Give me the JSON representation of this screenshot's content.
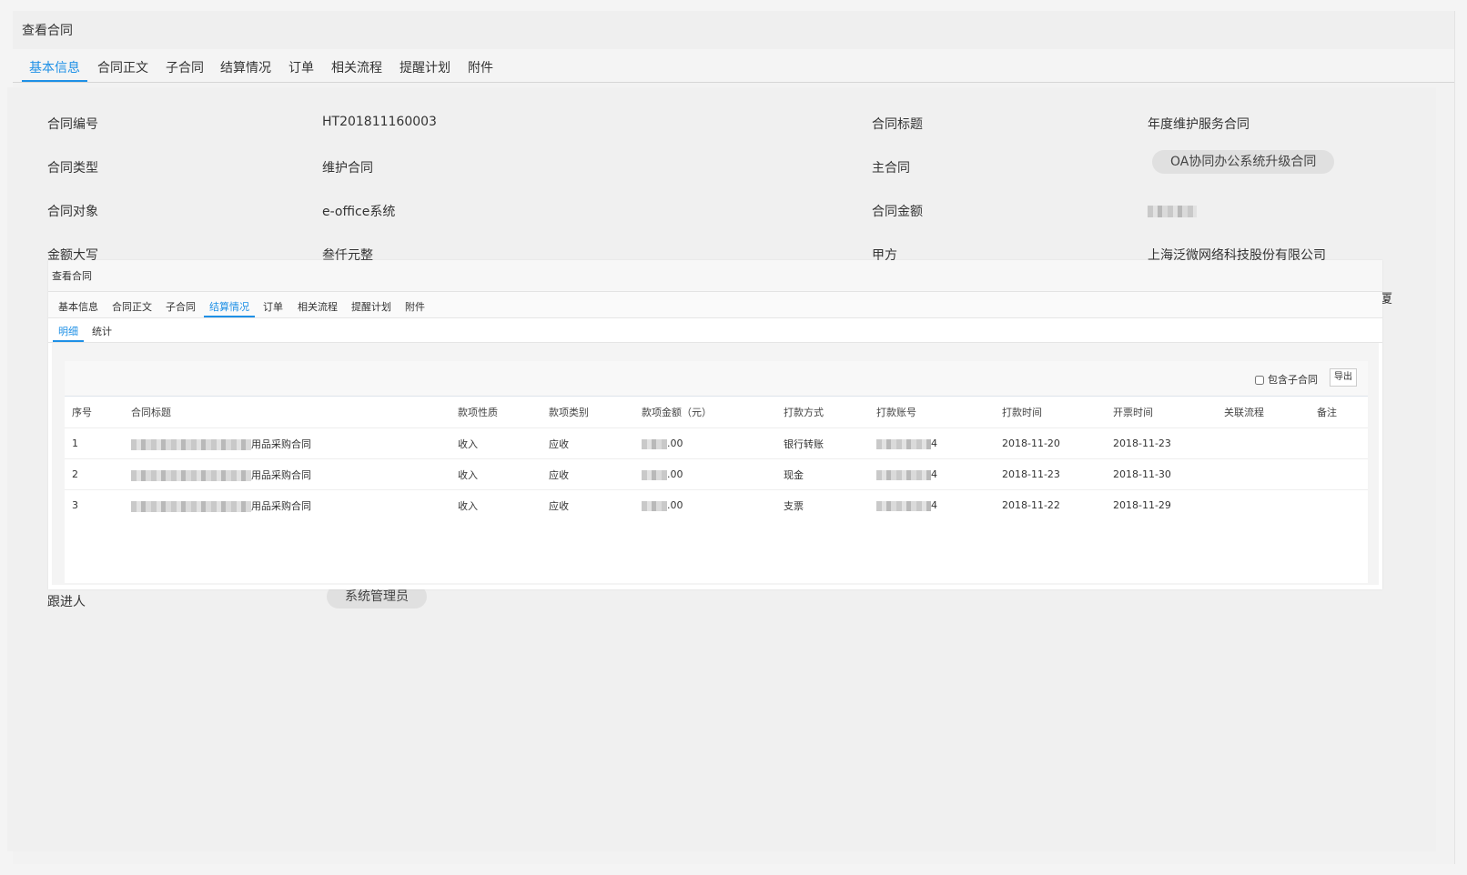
{
  "window": {
    "title": "查看合同"
  },
  "tabs": [
    "基本信息",
    "合同正文",
    "子合同",
    "结算情况",
    "订单",
    "相关流程",
    "提醒计划",
    "附件"
  ],
  "info": {
    "contract_no_label": "合同编号",
    "contract_no": "HT201811160003",
    "title_label": "合同标题",
    "title": "年度维护服务合同",
    "type_label": "合同类型",
    "type": "维护合同",
    "main_label": "主合同",
    "main": "OA协同办公系统升级合同",
    "object_label": "合同对象",
    "object": "e-office系统",
    "amount_label": "合同金额",
    "amount_cn_label": "金额大写",
    "amount_cn": "叁仟元整",
    "party_a_label": "甲方",
    "party_a": "上海泛微网络科技股份有限公司",
    "partial_char": "厦",
    "follower_label": "跟进人",
    "follower": "系统管理员"
  },
  "overlay": {
    "title": "查看合同",
    "tabs": [
      "基本信息",
      "合同正文",
      "子合同",
      "结算情况",
      "订单",
      "相关流程",
      "提醒计划",
      "附件"
    ],
    "subtabs": [
      "明细",
      "统计"
    ],
    "include_child": "包含子合同",
    "export": "导出",
    "columns": [
      "序号",
      "合同标题",
      "款项性质",
      "款项类别",
      "款项金额（元）",
      "打款方式",
      "打款账号",
      "打款时间",
      "开票时间",
      "关联流程",
      "备注"
    ],
    "rows": [
      {
        "no": "1",
        "title": "用品采购合同",
        "nature": "收入",
        "category": "应收",
        "amount": ".00",
        "method": "银行转账",
        "account_end": "4",
        "pay_date": "2018-11-20",
        "invoice_date": "2018-11-23",
        "flow": "",
        "remark": ""
      },
      {
        "no": "2",
        "title": "用品采购合同",
        "nature": "收入",
        "category": "应收",
        "amount": ".00",
        "method": "现金",
        "account_end": "4",
        "pay_date": "2018-11-23",
        "invoice_date": "2018-11-30",
        "flow": "",
        "remark": ""
      },
      {
        "no": "3",
        "title": "用品采购合同",
        "nature": "收入",
        "category": "应收",
        "amount": ".00",
        "method": "支票",
        "account_end": "4",
        "pay_date": "2018-11-22",
        "invoice_date": "2018-11-29",
        "flow": "",
        "remark": ""
      }
    ]
  },
  "colors": {
    "accent": "#1e90e6",
    "pill_bg": "#e0e0e0"
  }
}
